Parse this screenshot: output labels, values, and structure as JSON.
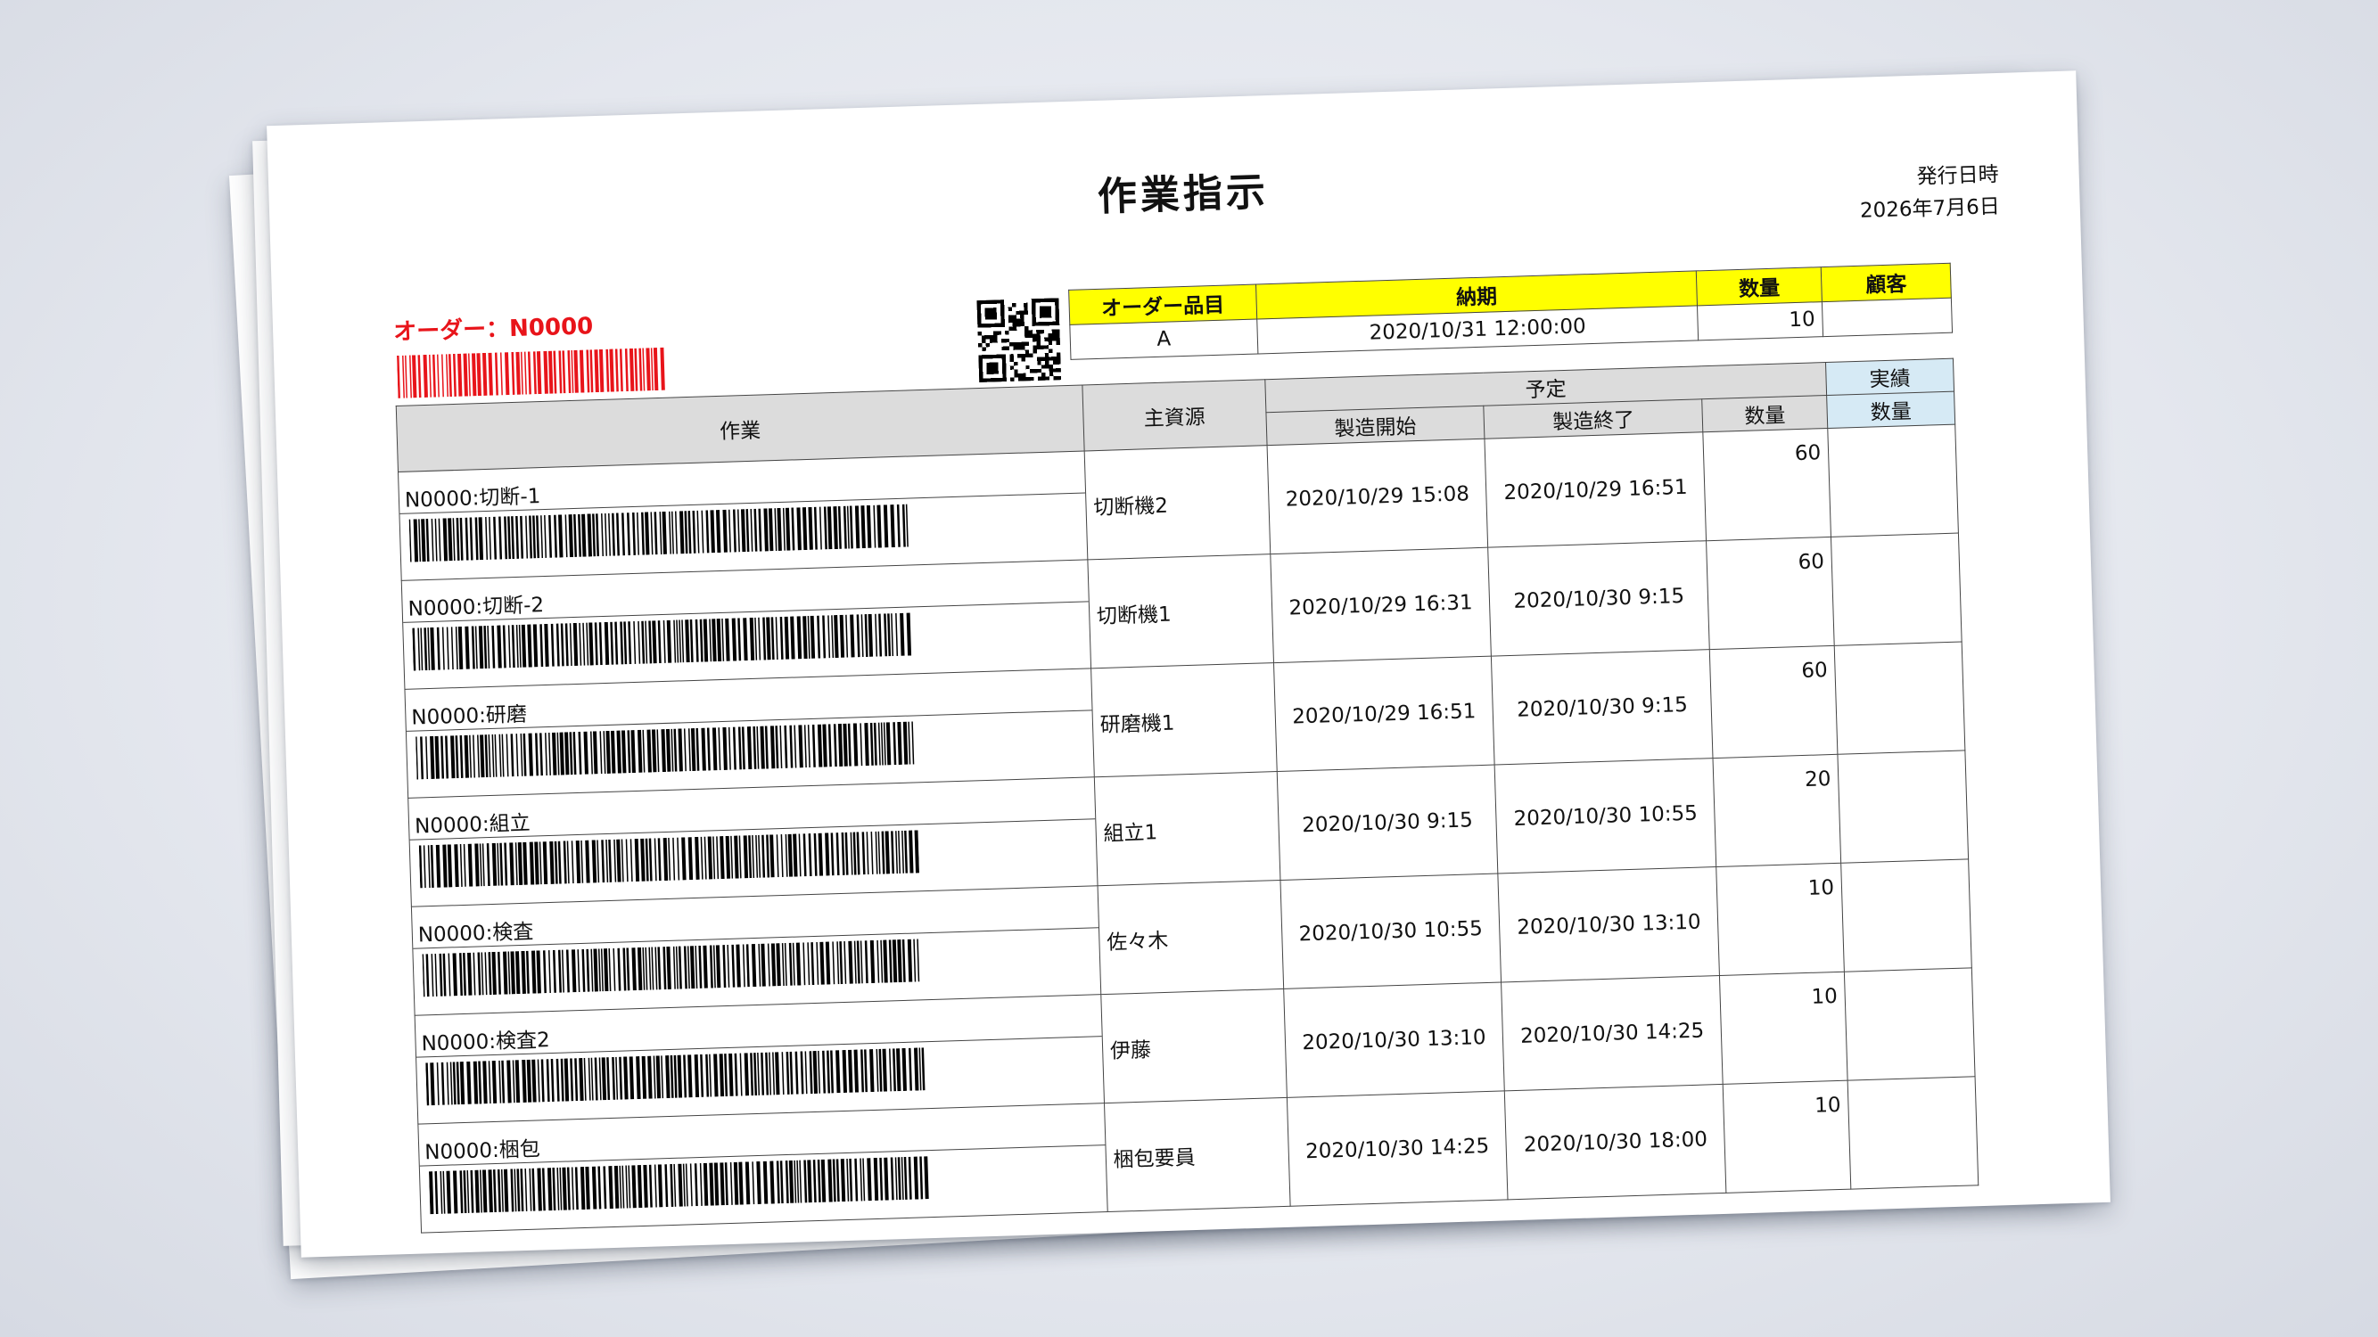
{
  "document": {
    "title": "作業指示",
    "issue_label": "発行日時",
    "issue_date": "2026年7月6日",
    "order_label": "オーダー：N0000"
  },
  "order_table": {
    "headers": {
      "item": "オーダー品目",
      "due": "納期",
      "qty": "数量",
      "customer": "顧客"
    },
    "values": {
      "item": "A",
      "due": "2020/10/31 12:00:00",
      "qty": "10",
      "customer": ""
    }
  },
  "main_table": {
    "headers": {
      "task": "作業",
      "resource": "主資源",
      "plan": "予定",
      "actual": "実績",
      "start": "製造開始",
      "end": "製造終了",
      "plan_qty": "数量",
      "actual_qty": "数量"
    },
    "rows": [
      {
        "task": "N0000:切断-1",
        "resource": "切断機2",
        "start": "2020/10/29 15:08",
        "end": "2020/10/29 16:51",
        "qty": "60"
      },
      {
        "task": "N0000:切断-2",
        "resource": "切断機1",
        "start": "2020/10/29 16:31",
        "end": "2020/10/30 9:15",
        "qty": "60"
      },
      {
        "task": "N0000:研磨",
        "resource": "研磨機1",
        "start": "2020/10/29 16:51",
        "end": "2020/10/30 9:15",
        "qty": "60"
      },
      {
        "task": "N0000:組立",
        "resource": "組立1",
        "start": "2020/10/30 9:15",
        "end": "2020/10/30 10:55",
        "qty": "20"
      },
      {
        "task": "N0000:検査",
        "resource": "佐々木",
        "start": "2020/10/30 10:55",
        "end": "2020/10/30 13:10",
        "qty": "10"
      },
      {
        "task": "N0000:検査2",
        "resource": "伊藤",
        "start": "2020/10/30 13:10",
        "end": "2020/10/30 14:25",
        "qty": "10"
      },
      {
        "task": "N0000:梱包",
        "resource": "梱包要員",
        "start": "2020/10/30 14:25",
        "end": "2020/10/30 18:00",
        "qty": "10"
      }
    ]
  },
  "colors": {
    "order_label": "#e8141a",
    "header_yellow": "#ffff00",
    "header_gray": "#dcdcdc",
    "header_blue": "#d6eaf5"
  }
}
